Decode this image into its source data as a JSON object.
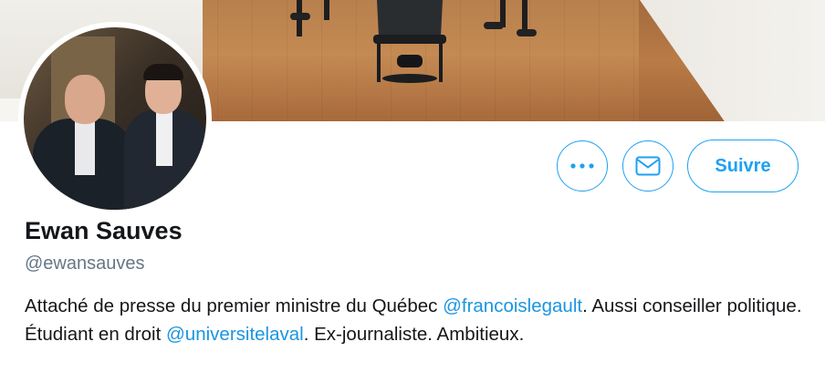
{
  "profile": {
    "display_name": "Ewan Sauves",
    "handle": "@ewansauves",
    "bio": {
      "part1": "Attaché de presse du premier ministre du Québec ",
      "mention1": "@francoislegault",
      "part2": ". Aussi conseiller politique. Étudiant en droit ",
      "mention2": "@universitelaval",
      "part3": ". Ex-journaliste. Ambitieux."
    }
  },
  "actions": {
    "more_icon": "more-dots-icon",
    "message_icon": "mail-icon",
    "follow_label": "Suivre"
  },
  "colors": {
    "accent": "#1da1f2",
    "link": "#1b95e0",
    "text": "#14171a",
    "secondary_text": "#657786"
  }
}
